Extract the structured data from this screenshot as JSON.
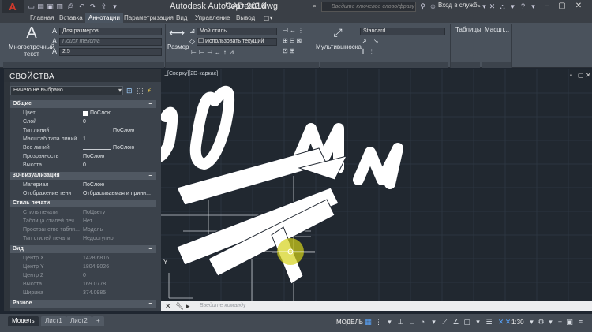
{
  "window": {
    "app_title": "Autodesk AutoCAD 2016",
    "file_title": "Чертеж2.dwg",
    "search_placeholder": "Введите ключевое слово/фразу",
    "login_label": "Вход в службы",
    "app_icon": "autocad-logo-icon"
  },
  "ribbon_tabs": [
    "Главная",
    "Вставка",
    "Аннотации",
    "Параметризация",
    "Вид",
    "Управление",
    "Вывод"
  ],
  "ribbon_active_tab": "Аннотации",
  "ribbon": {
    "multiline_text_label": "Многострочный текст",
    "text_style_value": "Для размеров",
    "text_search_placeholder": "Поиск текста",
    "text_height_value": "2.5",
    "dimension_label": "Размер",
    "dim_style_value": "Мой стиль",
    "use_current_label": "Использовать текущий",
    "multileader_label": "Мультивыноска",
    "mleader_style_value": "Standard",
    "tables_label": "Таблицы",
    "scale_label": "Масшт..."
  },
  "properties": {
    "title": "СВОЙСТВА",
    "selection_value": "Ничего не выбрано",
    "sections": {
      "general": "Общие",
      "viz3d": "3D-визуализация",
      "plot_style": "Стиль печати",
      "view": "Вид",
      "misc": "Разное"
    },
    "general_rows": [
      {
        "label": "Цвет",
        "value": "ПоСлою"
      },
      {
        "label": "Слой",
        "value": "0"
      },
      {
        "label": "Тип линий",
        "value": "ПоСлою"
      },
      {
        "label": "Масштаб типа линий",
        "value": "1"
      },
      {
        "label": "Вес линий",
        "value": "ПоСлою"
      },
      {
        "label": "Прозрачность",
        "value": "ПоСлою"
      },
      {
        "label": "Высота",
        "value": "0"
      }
    ],
    "viz_rows": [
      {
        "label": "Материал",
        "value": "ПоСлою"
      },
      {
        "label": "Отображение тени",
        "value": "Отбрасываемая и прини..."
      }
    ],
    "plot_rows": [
      {
        "label": "Стиль печати",
        "value": "ПоЦвету"
      },
      {
        "label": "Таблица стилей печ...",
        "value": "Нет"
      },
      {
        "label": "Пространство табли...",
        "value": "Модель"
      },
      {
        "label": "Тип стилей печати",
        "value": "Недоступно"
      }
    ],
    "view_rows": [
      {
        "label": "Центр X",
        "value": "1428.6816"
      },
      {
        "label": "Центр Y",
        "value": "1804.9026"
      },
      {
        "label": "Центр Z",
        "value": "0"
      },
      {
        "label": "Высота",
        "value": "169.0778"
      },
      {
        "label": "Ширина",
        "value": "374.0985"
      }
    ]
  },
  "viewport": {
    "label": "[Сверху][2D-каркас]",
    "drawing_text": "30 мм",
    "ucs_y": "Y"
  },
  "command": {
    "placeholder": "Введите команду"
  },
  "status": {
    "tabs": [
      "Модель",
      "Лист1",
      "Лист2"
    ],
    "active_tab": "Модель",
    "add_tab": "+",
    "model_label": "МОДЕЛЬ",
    "scale": "1:30"
  },
  "colors": {
    "accent": "#4b5561",
    "viewport_bg": "#212830",
    "drawing_stroke": "#ffffff",
    "cursor_highlight": "#d4d21a"
  }
}
